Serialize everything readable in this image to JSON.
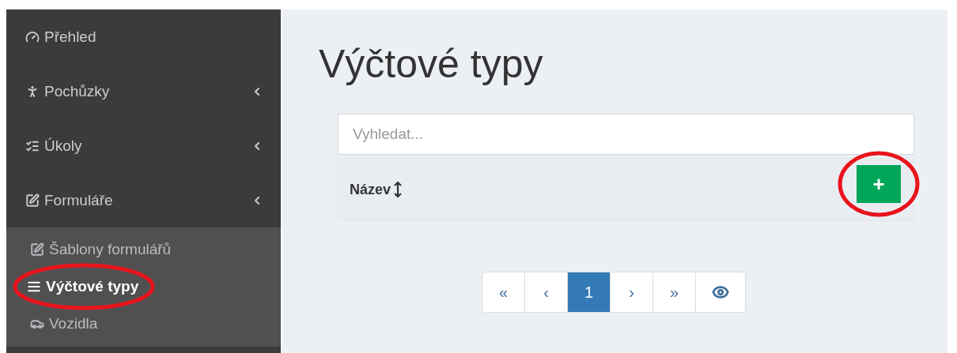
{
  "sidebar": {
    "items": [
      {
        "label": "Přehled",
        "expandable": false
      },
      {
        "label": "Pochůzky",
        "expandable": true
      },
      {
        "label": "Úkoly",
        "expandable": true
      },
      {
        "label": "Formuláře",
        "expandable": true,
        "children": [
          {
            "label": "Šablony formulářů",
            "selected": false,
            "circled": false
          },
          {
            "label": "Výčtové typy",
            "selected": true,
            "circled": true
          },
          {
            "label": "Vozidla",
            "selected": false,
            "circled": false
          }
        ]
      }
    ]
  },
  "page": {
    "title": "Výčtové typy",
    "search": {
      "placeholder": "Vyhledat..."
    },
    "table": {
      "columns": [
        {
          "label": "Název",
          "sortable": true
        }
      ],
      "add_button": {
        "label": "+",
        "circled": true
      }
    },
    "pagination": [
      {
        "label": "«",
        "kind": "text",
        "selected": false
      },
      {
        "label": "‹",
        "kind": "text",
        "selected": false
      },
      {
        "label": "1",
        "kind": "text",
        "selected": true
      },
      {
        "label": "›",
        "kind": "text",
        "selected": false
      },
      {
        "label": "»",
        "kind": "text",
        "selected": false
      },
      {
        "kind": "eye",
        "selected": false
      }
    ]
  }
}
